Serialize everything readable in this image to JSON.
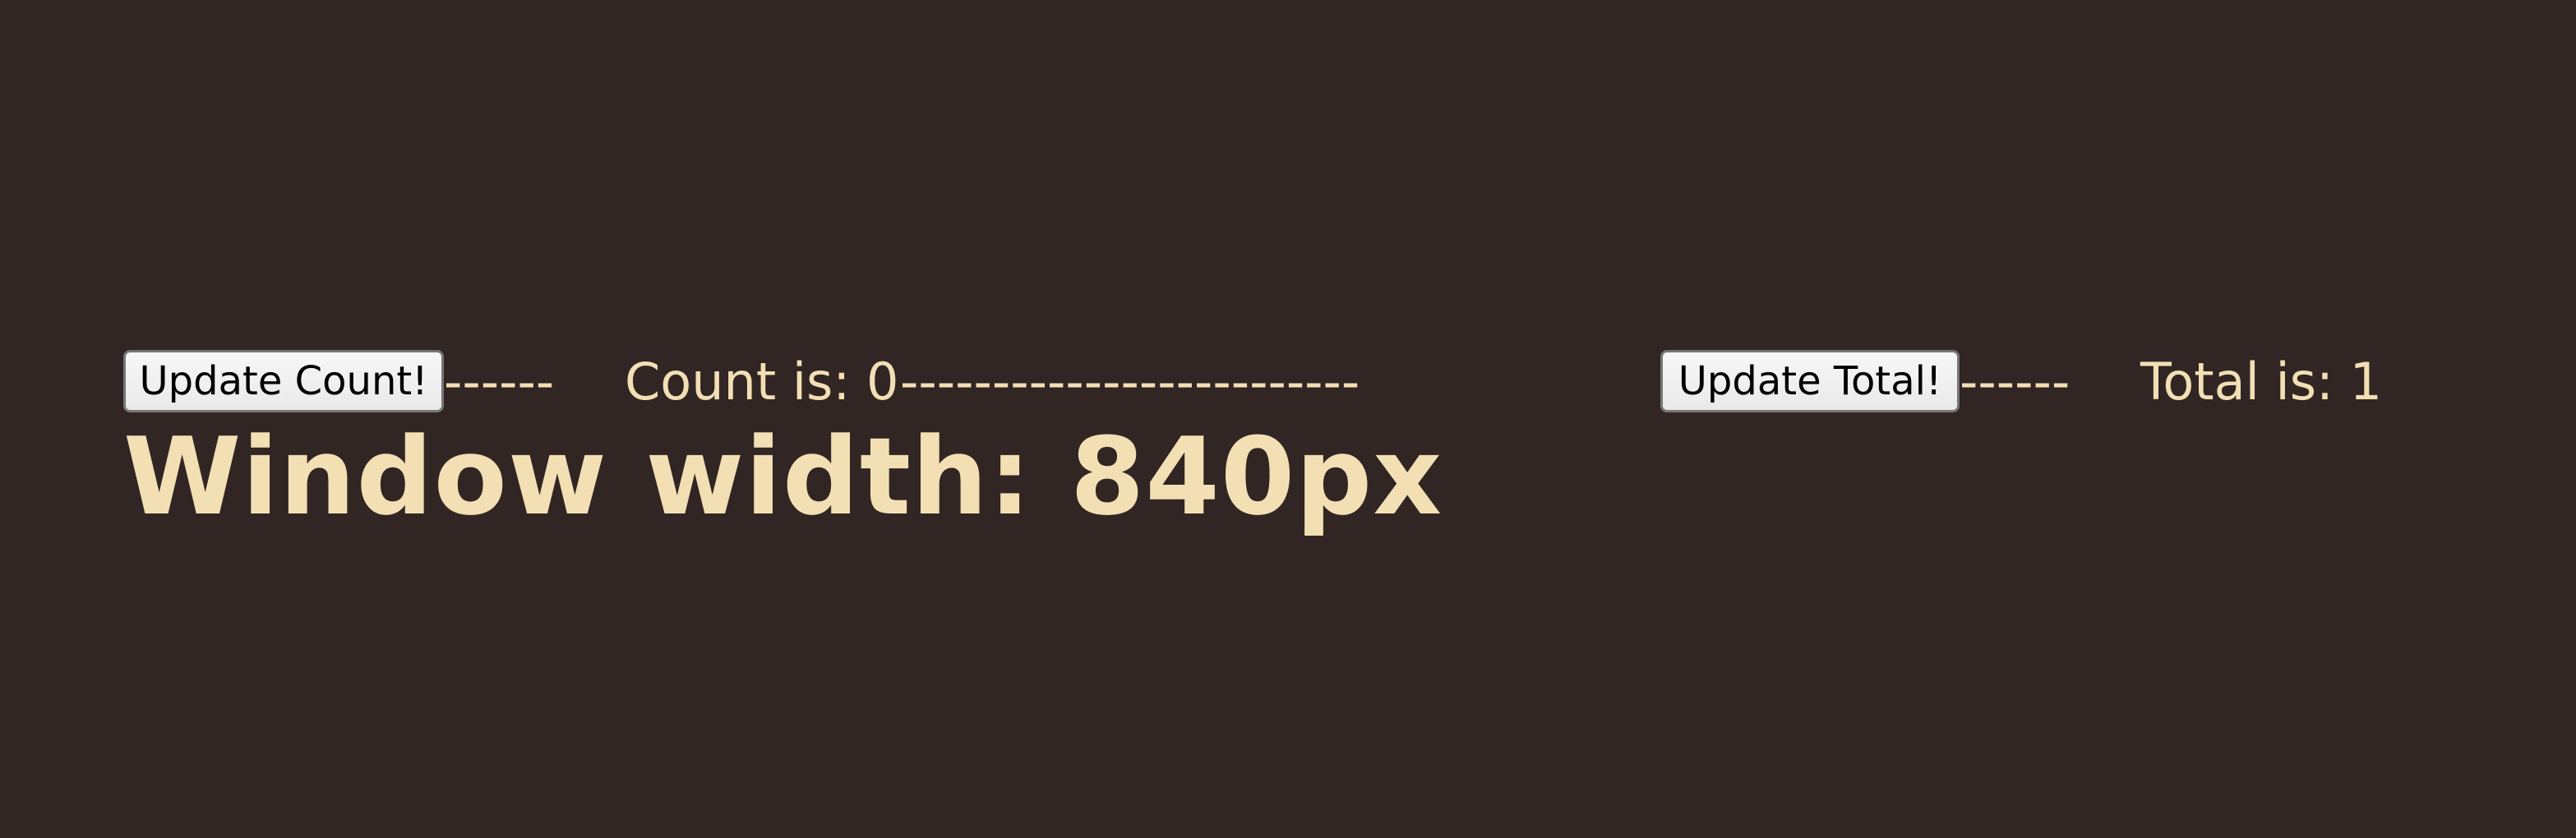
{
  "counter": {
    "update_count_label": "Update Count!",
    "count_text": "Count is: 0",
    "update_total_label": "Update Total!",
    "total_text": "Total is: 1",
    "separator_short": "------",
    "separator_long": "-------------------------"
  },
  "window": {
    "width_text": "Window width: 840px"
  },
  "colors": {
    "background": "#312624",
    "text": "#f2dfb4"
  }
}
